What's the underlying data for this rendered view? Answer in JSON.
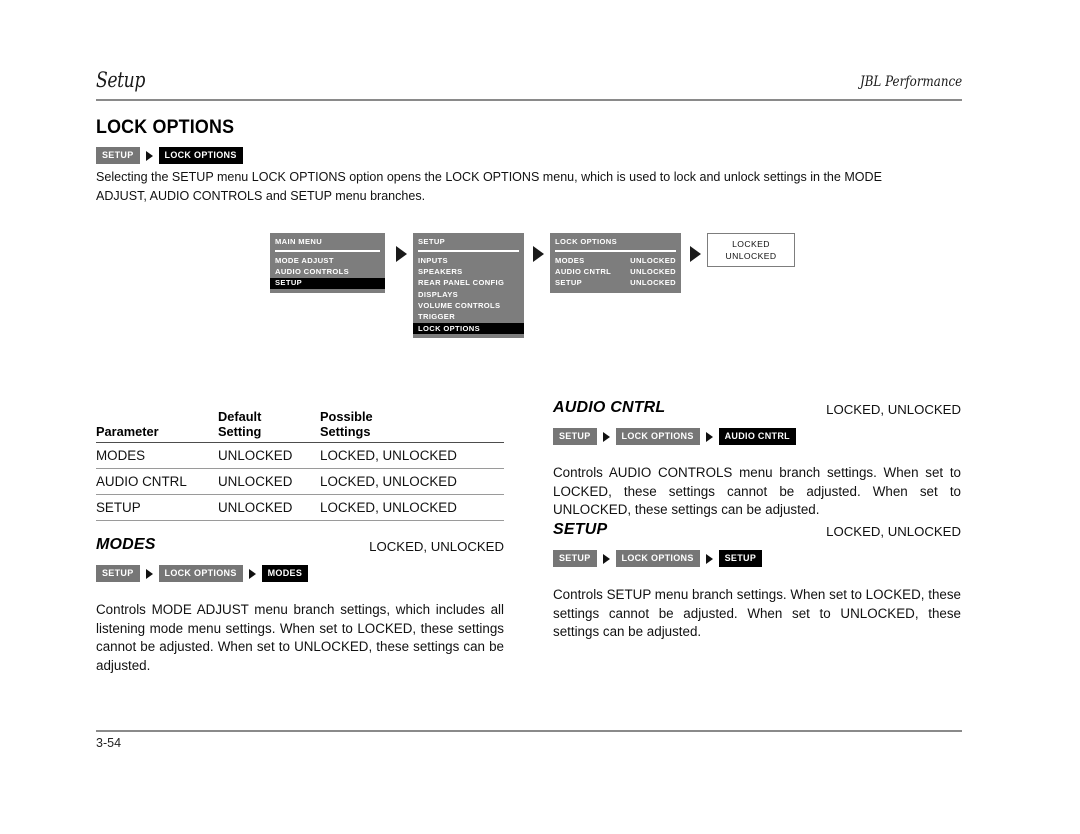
{
  "header": {
    "chapter": "Setup",
    "brand": "JBL Performance"
  },
  "page_title": "LOCK OPTIONS",
  "title_crumbs": [
    {
      "label": "SETUP",
      "style": "gray"
    },
    {
      "label": "LOCK OPTIONS",
      "style": "black"
    }
  ],
  "intro": "Selecting the SETUP menu LOCK OPTIONS option opens the LOCK OPTIONS menu, which is used to lock and unlock settings in the MODE ADJUST, AUDIO CONTROLS and SETUP menu branches.",
  "flow": {
    "main_menu": {
      "title": "MAIN MENU",
      "items": [
        {
          "label": "MODE ADJUST",
          "value": "",
          "selected": false
        },
        {
          "label": "AUDIO CONTROLS",
          "value": "",
          "selected": false
        },
        {
          "label": "SETUP",
          "value": "",
          "selected": true
        }
      ]
    },
    "setup_menu": {
      "title": "SETUP",
      "items": [
        {
          "label": "INPUTS",
          "value": "",
          "selected": false
        },
        {
          "label": "SPEAKERS",
          "value": "",
          "selected": false
        },
        {
          "label": "REAR PANEL CONFIG",
          "value": "",
          "selected": false
        },
        {
          "label": "DISPLAYS",
          "value": "",
          "selected": false
        },
        {
          "label": "VOLUME CONTROLS",
          "value": "",
          "selected": false
        },
        {
          "label": "TRIGGER",
          "value": "",
          "selected": false
        },
        {
          "label": "LOCK OPTIONS",
          "value": "",
          "selected": true
        }
      ]
    },
    "lock_options_menu": {
      "title": "LOCK OPTIONS",
      "items": [
        {
          "label": "MODES",
          "value": "UNLOCKED",
          "selected": false
        },
        {
          "label": "AUDIO CNTRL",
          "value": "UNLOCKED",
          "selected": false
        },
        {
          "label": "SETUP",
          "value": "UNLOCKED",
          "selected": false
        }
      ]
    },
    "values_box": {
      "lines": [
        "LOCKED",
        "UNLOCKED"
      ]
    }
  },
  "table": {
    "headers": {
      "parameter": "Parameter",
      "default_line1": "Default",
      "default_line2": "Setting",
      "possible_line1": "Possible",
      "possible_line2": "Settings"
    },
    "rows": [
      {
        "parameter": "MODES",
        "default": "UNLOCKED",
        "possible": "LOCKED, UNLOCKED"
      },
      {
        "parameter": "AUDIO CNTRL",
        "default": "UNLOCKED",
        "possible": "LOCKED, UNLOCKED"
      },
      {
        "parameter": "SETUP",
        "default": "UNLOCKED",
        "possible": "LOCKED, UNLOCKED"
      }
    ]
  },
  "sections": {
    "modes": {
      "title": "MODES",
      "range": "LOCKED, UNLOCKED",
      "crumbs": [
        {
          "label": "SETUP",
          "style": "gray"
        },
        {
          "label": "LOCK OPTIONS",
          "style": "gray"
        },
        {
          "label": "MODES",
          "style": "black"
        }
      ],
      "body": "Controls MODE ADJUST menu branch settings, which includes all listening mode menu settings. When set to LOCKED, these settings cannot be adjusted. When set to UNLOCKED, these settings can be adjusted."
    },
    "audio_cntrl": {
      "title": "AUDIO CNTRL",
      "range": "LOCKED, UNLOCKED",
      "crumbs": [
        {
          "label": "SETUP",
          "style": "gray"
        },
        {
          "label": "LOCK OPTIONS",
          "style": "gray"
        },
        {
          "label": "AUDIO CNTRL",
          "style": "black"
        }
      ],
      "body": "Controls AUDIO CONTROLS menu branch settings. When set to LOCKED, these settings cannot be adjusted. When set to UNLOCKED, these settings can be adjusted."
    },
    "setup": {
      "title": "SETUP",
      "range": "LOCKED, UNLOCKED",
      "crumbs": [
        {
          "label": "SETUP",
          "style": "gray"
        },
        {
          "label": "LOCK OPTIONS",
          "style": "gray"
        },
        {
          "label": "SETUP",
          "style": "black"
        }
      ],
      "body": "Controls SETUP menu branch settings. When set to LOCKED, these settings cannot be adjusted. When set to UNLOCKED, these settings can be adjusted."
    }
  },
  "footer": {
    "page_number": "3-54"
  },
  "colors": {
    "crumb_gray": "#767676",
    "crumb_black": "#000000",
    "menu_bg": "#7d7d7d",
    "menu_selected": "#000000",
    "rule": "#8a8a8a"
  }
}
